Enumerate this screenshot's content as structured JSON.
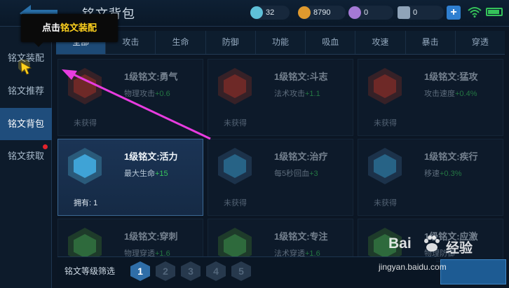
{
  "header": {
    "title": "铭文背包",
    "resources": [
      {
        "icon": "diamond-icon",
        "value": "32",
        "color": "#5fc0d8"
      },
      {
        "icon": "gold-coin-icon",
        "value": "8790",
        "color": "#e09a2e"
      },
      {
        "icon": "purple-crystal-icon",
        "value": "0",
        "color": "#a57ad6"
      },
      {
        "icon": "inscription-fragment-icon",
        "value": "0",
        "color": "#8fa3b8"
      }
    ],
    "plus_label": "+"
  },
  "sidebar": {
    "items": [
      {
        "label": "铭文装配",
        "active": false
      },
      {
        "label": "铭文推荐",
        "active": false
      },
      {
        "label": "铭文背包",
        "active": true
      },
      {
        "label": "铭文获取",
        "active": false,
        "badge": true
      }
    ]
  },
  "tabs": [
    {
      "label": "全部",
      "active": true
    },
    {
      "label": "攻击"
    },
    {
      "label": "生命"
    },
    {
      "label": "防御"
    },
    {
      "label": "功能"
    },
    {
      "label": "吸血"
    },
    {
      "label": "攻速"
    },
    {
      "label": "暴击"
    },
    {
      "label": "穿透"
    }
  ],
  "cards": [
    {
      "name": "1级铭文:勇气",
      "attr": "物理攻击",
      "bonus": "+0.6",
      "status": "未获得",
      "color": "#c0392b"
    },
    {
      "name": "1级铭文:斗志",
      "attr": "法术攻击",
      "bonus": "+1.1",
      "status": "未获得",
      "color": "#c0392b"
    },
    {
      "name": "1级铭文:猛攻",
      "attr": "攻击速度",
      "bonus": "+0.4%",
      "status": "未获得",
      "color": "#c0392b"
    },
    {
      "name": "1级铭文:活力",
      "attr": "最大生命",
      "bonus": "+15",
      "status": "拥有: 1",
      "color": "#3fa3d6",
      "owned": true
    },
    {
      "name": "1级铭文:治疗",
      "attr": "每5秒回血",
      "bonus": "+3",
      "status": "未获得",
      "color": "#3fa3d6"
    },
    {
      "name": "1级铭文:疾行",
      "attr": "移速",
      "bonus": "+0.3%",
      "status": "未获得",
      "color": "#3fa3d6"
    },
    {
      "name": "1级铭文:穿刺",
      "attr": "物理穿透",
      "bonus": "+1.6",
      "status": "",
      "color": "#4caf50"
    },
    {
      "name": "1级铭文:专注",
      "attr": "法术穿透",
      "bonus": "+1.6",
      "status": "",
      "color": "#4caf50"
    },
    {
      "name": "1级铭文:应激",
      "attr": "物理防御",
      "bonus": "",
      "status": "",
      "color": "#4caf50"
    }
  ],
  "filter": {
    "label": "铭文等级筛选",
    "levels": [
      "1",
      "2",
      "3",
      "4",
      "5"
    ],
    "selected": "1"
  },
  "tooltip": {
    "prefix": "点击",
    "highlight": "铭文装配"
  },
  "watermark": {
    "logo_text": "Bai",
    "logo_suffix": "经验",
    "url": "jingyan.baidu.com"
  }
}
